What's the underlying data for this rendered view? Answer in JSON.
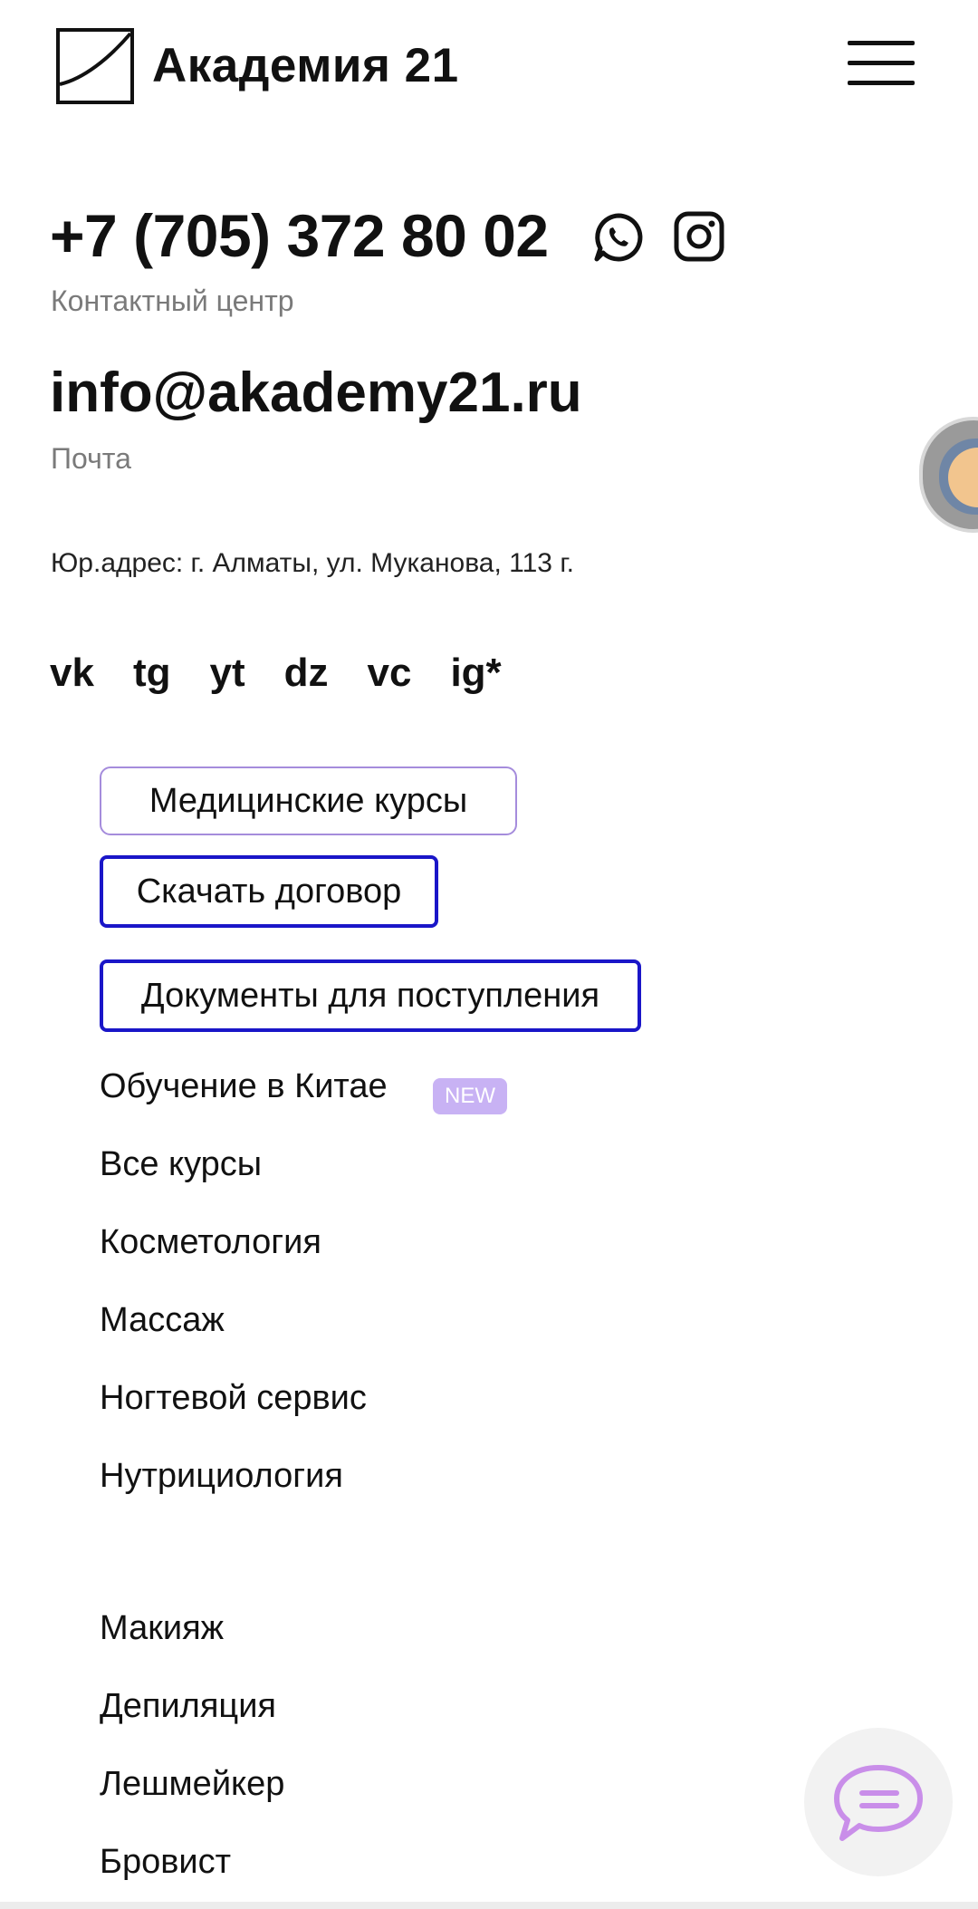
{
  "header": {
    "brand": "Академия 21"
  },
  "contacts": {
    "phone": "+7 (705) 372 80 02",
    "phone_caption": "Контактный центр",
    "email": "info@akademy21.ru",
    "email_caption": "Почта",
    "address": "Юр.адрес: г. Алматы, ул. Муканова, 113 г."
  },
  "socials": [
    "vk",
    "tg",
    "yt",
    "dz",
    "vc",
    "ig*"
  ],
  "buttons": {
    "medical": "Медицинские курсы",
    "contract": "Скачать договор",
    "documents": "Документы для поступления"
  },
  "menu": {
    "china": "Обучение в Китае",
    "china_badge": "NEW",
    "items_group1": [
      "Все курсы",
      "Косметология",
      "Массаж",
      "Ногтевой сервис",
      "Нутрициология"
    ],
    "items_group2": [
      "Макияж",
      "Депиляция",
      "Лешмейкер",
      "Бровист"
    ]
  },
  "colors": {
    "accent_blue": "#1a16c8",
    "accent_purple": "#a58cdc",
    "badge": "#c8b2f4",
    "chat_icon": "#c98ee9"
  },
  "icons": [
    "logo-mark-icon",
    "hamburger-menu-icon",
    "whatsapp-icon",
    "instagram-icon",
    "chat-bubble-icon"
  ]
}
